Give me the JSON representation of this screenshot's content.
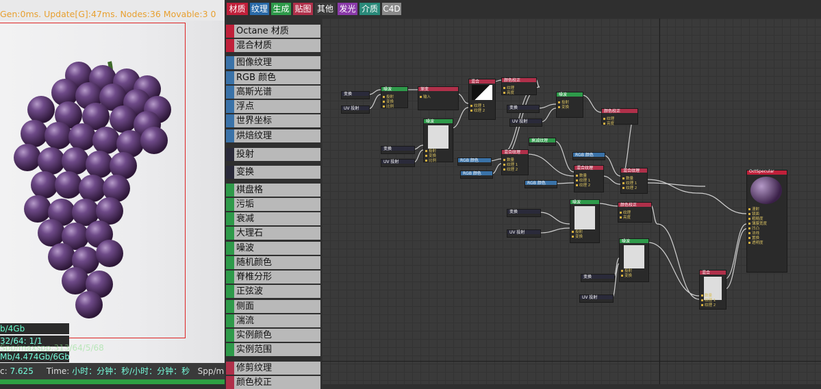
{
  "viewport": {
    "status_top": "Gen:0ms. Update[G]:47ms. Nodes:36 Movable:3  0",
    "mem_label": "b/4Gb",
    "spp_prefix": "32/64: ",
    "spp_value": "1/1",
    "maxspp": "Spp/maxspp:313/64/5/68",
    "gpu_mem": "Mb/4.474Gb/6Gb",
    "bottom": {
      "c_label": "c: ",
      "c_value": "7.625",
      "time_label": "Time: ",
      "time_value": "小时：分钟：秒/小时：分钟：秒",
      "spp_label": "Spp/ma"
    },
    "progress": 1.0
  },
  "tabs": [
    {
      "label": "材质",
      "color": "#c0203a"
    },
    {
      "label": "纹理",
      "color": "#2a6aa8"
    },
    {
      "label": "生成",
      "color": "#2e9a4a"
    },
    {
      "label": "贴图",
      "color": "#b0304a"
    },
    {
      "label": "其他",
      "color": "#3a3a3a"
    },
    {
      "label": "发光",
      "color": "#8a3aa8"
    },
    {
      "label": "介质",
      "color": "#2a8a7a"
    },
    {
      "label": "C4D",
      "color": "#8a8a8a"
    }
  ],
  "node_list": [
    {
      "label": "Octane 材质",
      "color": "#c0203a"
    },
    {
      "label": "混合材质",
      "color": "#c0203a"
    },
    {
      "label": "图像纹理",
      "color": "#3a72a8"
    },
    {
      "label": "RGB 颜色",
      "color": "#3a72a8"
    },
    {
      "label": "高斯光谱",
      "color": "#3a72a8"
    },
    {
      "label": "浮点",
      "color": "#3a72a8"
    },
    {
      "label": "世界坐标",
      "color": "#3a72a8"
    },
    {
      "label": "烘焙纹理",
      "color": "#3a72a8"
    },
    {
      "label": "投射",
      "color": "#2a2a3a"
    },
    {
      "label": "变换",
      "color": "#2a2a3a"
    },
    {
      "label": "棋盘格",
      "color": "#2e9a4a"
    },
    {
      "label": "污垢",
      "color": "#2e9a4a"
    },
    {
      "label": "衰减",
      "color": "#2e9a4a"
    },
    {
      "label": "大理石",
      "color": "#2e9a4a"
    },
    {
      "label": "噪波",
      "color": "#2e9a4a"
    },
    {
      "label": "随机颜色",
      "color": "#2e9a4a"
    },
    {
      "label": "脊椎分形",
      "color": "#2e9a4a"
    },
    {
      "label": "正弦波",
      "color": "#2e9a4a"
    },
    {
      "label": "侧面",
      "color": "#2e9a4a"
    },
    {
      "label": "湍流",
      "color": "#2e9a4a"
    },
    {
      "label": "实例颜色",
      "color": "#2e9a4a"
    },
    {
      "label": "实例范围",
      "color": "#2e9a4a"
    },
    {
      "label": "修剪纹理",
      "color": "#b0304a"
    },
    {
      "label": "颜色校正",
      "color": "#b0304a"
    }
  ],
  "graph": {
    "nodes": [
      {
        "id": "n1",
        "title": "变换",
        "color": "#2a2a3a",
        "pins": []
      },
      {
        "id": "n2",
        "title": "UV 投射",
        "color": "#2a2a3a",
        "pins": []
      },
      {
        "id": "n3",
        "title": "噪波",
        "color": "#2e9a4a",
        "pins": [
          "投射",
          "变换",
          "比例"
        ]
      },
      {
        "id": "n4",
        "title": "渐变",
        "color": "#b0304a",
        "pins": [
          "输入"
        ]
      },
      {
        "id": "n5",
        "title": "混合",
        "color": "#b0304a",
        "pins": [
          "纹理 1",
          "纹理 2"
        ]
      },
      {
        "id": "n6",
        "title": "颜色校正",
        "color": "#b0304a",
        "pins": [
          "纹理",
          "亮度"
        ]
      },
      {
        "id": "n7",
        "title": "噪波",
        "color": "#2e9a4a",
        "pins": [
          "投射",
          "变换",
          "比例"
        ]
      },
      {
        "id": "n8",
        "title": "变换",
        "color": "#2a2a3a",
        "pins": []
      },
      {
        "id": "n9",
        "title": "UV 投射",
        "color": "#2a2a3a",
        "pins": []
      },
      {
        "id": "n10",
        "title": "噪波",
        "color": "#2e9a4a",
        "pins": [
          "投射",
          "变换"
        ]
      },
      {
        "id": "n11",
        "title": "颜色校正",
        "color": "#b0304a",
        "pins": [
          "纹理",
          "亮度"
        ]
      },
      {
        "id": "n12",
        "title": "变换",
        "color": "#2a2a3a",
        "pins": []
      },
      {
        "id": "n13",
        "title": "UV 投射",
        "color": "#2a2a3a",
        "pins": []
      },
      {
        "id": "n14",
        "title": "RGB 颜色",
        "color": "#3a72a8",
        "pins": []
      },
      {
        "id": "n15",
        "title": "RGB 颜色",
        "color": "#3a72a8",
        "pins": []
      },
      {
        "id": "n16",
        "title": "混合纹理",
        "color": "#b0304a",
        "pins": [
          "数量",
          "纹理 1",
          "纹理 2"
        ]
      },
      {
        "id": "n17",
        "title": "衰减纹理",
        "color": "#2e9a4a",
        "pins": []
      },
      {
        "id": "n18",
        "title": "RGB 颜色",
        "color": "#3a72a8",
        "pins": []
      },
      {
        "id": "n19",
        "title": "RGB 颜色",
        "color": "#3a72a8",
        "pins": []
      },
      {
        "id": "n20",
        "title": "混合纹理",
        "color": "#b0304a",
        "pins": [
          "数量",
          "纹理 1",
          "纹理 2"
        ]
      },
      {
        "id": "n21",
        "title": "混合纹理",
        "color": "#b0304a",
        "pins": [
          "数量",
          "纹理 1",
          "纹理 2"
        ]
      },
      {
        "id": "n22",
        "title": "噪波",
        "color": "#2e9a4a",
        "pins": [
          "投射",
          "变换"
        ]
      },
      {
        "id": "n23",
        "title": "颜色校正",
        "color": "#b0304a",
        "pins": [
          "纹理",
          "亮度"
        ]
      },
      {
        "id": "n24",
        "title": "变换",
        "color": "#2a2a3a",
        "pins": []
      },
      {
        "id": "n25",
        "title": "UV 投射",
        "color": "#2a2a3a",
        "pins": []
      },
      {
        "id": "n26",
        "title": "噪波",
        "color": "#2e9a4a",
        "pins": [
          "投射",
          "变换"
        ]
      },
      {
        "id": "n27",
        "title": "变换",
        "color": "#2a2a3a",
        "pins": []
      },
      {
        "id": "n28",
        "title": "UV 投射",
        "color": "#2a2a3a",
        "pins": []
      },
      {
        "id": "n29",
        "title": "混合",
        "color": "#b0304a",
        "pins": [
          "数量",
          "纹理 1",
          "纹理 2"
        ]
      },
      {
        "id": "n30",
        "title": "OctSpecular",
        "color": "#c0203a",
        "pins": [
          "漫射",
          "镜面",
          "粗糙度",
          "薄膜宽度",
          "凹凸",
          "法线",
          "置换",
          "透明度"
        ]
      }
    ]
  }
}
